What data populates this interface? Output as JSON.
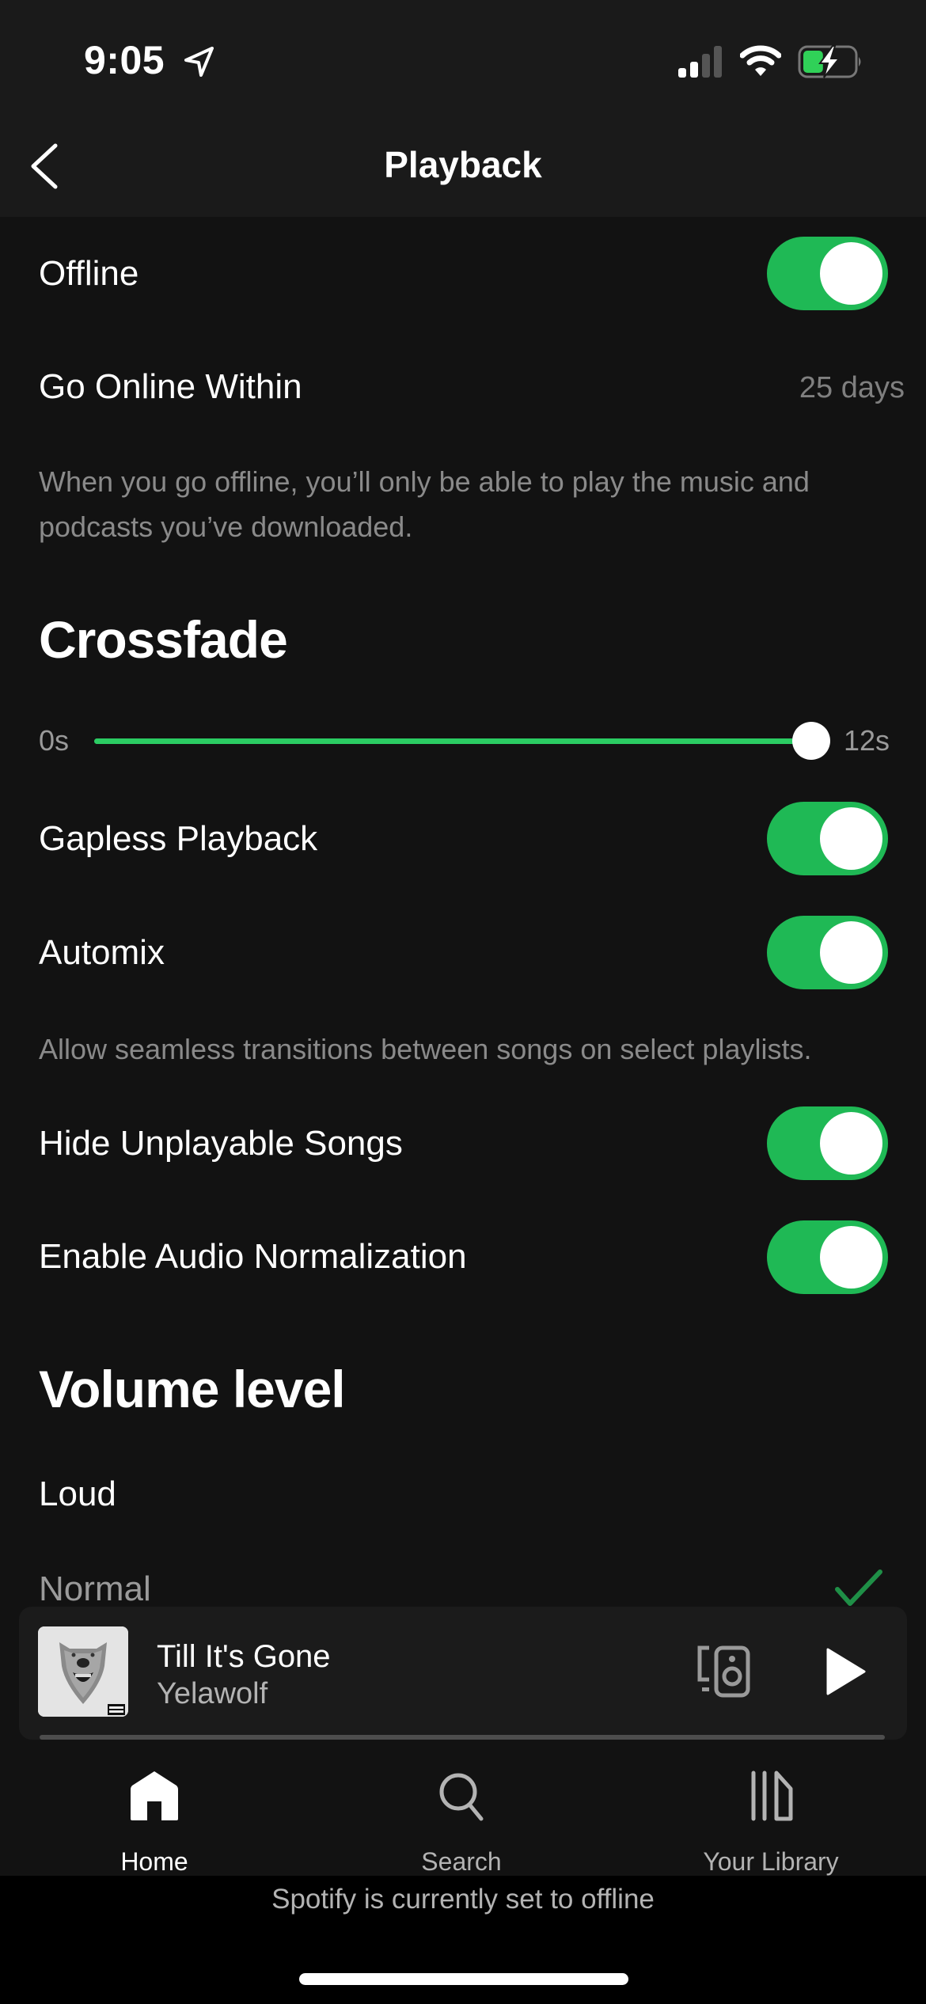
{
  "status_bar": {
    "time": "9:05",
    "location_icon": "location-arrow-icon",
    "signal_bars_active": 2,
    "signal_bars_total": 4,
    "wifi_icon": "wifi-icon",
    "battery_level_percent": 40,
    "battery_charging": true
  },
  "header": {
    "title": "Playback",
    "back_icon": "chevron-left-icon"
  },
  "settings": {
    "offline": {
      "label": "Offline",
      "enabled": true
    },
    "go_online_within": {
      "label": "Go Online Within",
      "value": "25 days"
    },
    "offline_description": "When you go offline, you’ll only be able to play the music and podcasts you’ve downloaded.",
    "crossfade": {
      "title": "Crossfade",
      "min_label": "0s",
      "max_label": "12s",
      "min": 0,
      "max": 12,
      "value": 12
    },
    "gapless_playback": {
      "label": "Gapless Playback",
      "enabled": true
    },
    "automix": {
      "label": "Automix",
      "enabled": true
    },
    "automix_description": "Allow seamless transitions between songs on select playlists.",
    "hide_unplayable": {
      "label": "Hide Unplayable Songs",
      "enabled": true
    },
    "audio_normalization": {
      "label": "Enable Audio Normalization",
      "enabled": true
    },
    "volume_level": {
      "title": "Volume level",
      "options": [
        {
          "label": "Loud",
          "selected": false
        },
        {
          "label": "Normal",
          "selected": true
        }
      ]
    }
  },
  "mini_player": {
    "track_title": "Till It's Gone",
    "artist": "Yelawolf",
    "progress_fraction": 0,
    "devices_icon": "connect-devices-icon",
    "play_icon": "play-icon"
  },
  "tab_bar": {
    "tabs": [
      {
        "label": "Home",
        "icon": "home-icon",
        "active": true
      },
      {
        "label": "Search",
        "icon": "search-icon",
        "active": false
      },
      {
        "label": "Your Library",
        "icon": "library-icon",
        "active": false
      }
    ]
  },
  "offline_banner": "Spotify is currently set to offline",
  "colors": {
    "accent_green": "#1fb955",
    "background": "#121212",
    "header_background": "#1a1a1a",
    "secondary_text": "#b3b3b3"
  }
}
